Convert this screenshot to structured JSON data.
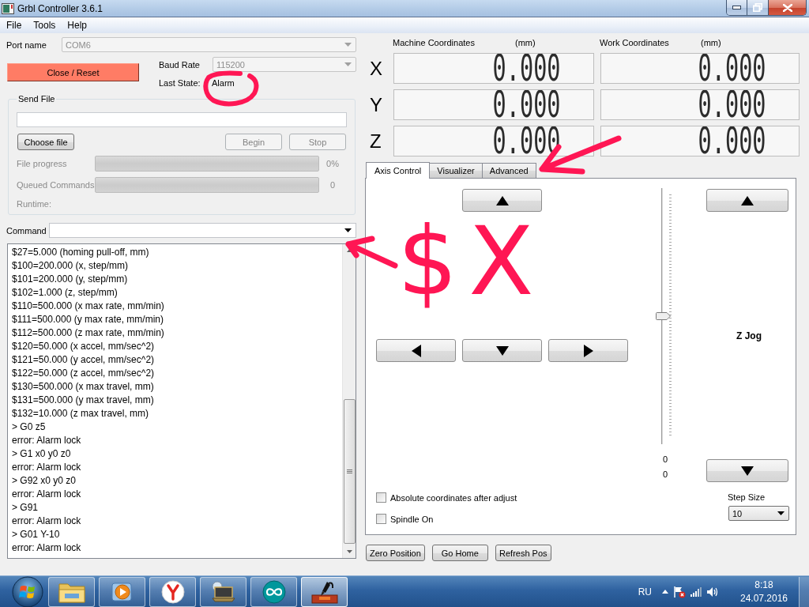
{
  "window": {
    "title": "Grbl Controller 3.6.1"
  },
  "menu": [
    "File",
    "Tools",
    "Help"
  ],
  "connection": {
    "port": {
      "label": "Port name",
      "value": "COM6",
      "disabled": true
    },
    "close_button": {
      "label": "Close / Reset"
    },
    "baud": {
      "label": "Baud Rate",
      "value": "115200",
      "disabled": true
    },
    "last_state": {
      "label": "Last State:",
      "value": "Alarm"
    }
  },
  "send_file": {
    "title": "Send File",
    "buttons": [
      {
        "label": "Choose file",
        "disabled": false
      },
      {
        "label": "Begin",
        "disabled": true
      },
      {
        "label": "Stop",
        "disabled": true
      }
    ],
    "progress": [
      {
        "label": "File progress",
        "level": 0,
        "reading": "0%",
        "disabled": true
      },
      {
        "label": "Queued Commands",
        "level": 0,
        "reading": "0",
        "disabled": true
      }
    ],
    "runtime": {
      "label": "Runtime:",
      "disabled": true
    }
  },
  "command": {
    "label": "Command"
  },
  "console": {
    "lines": [
      "$27=5.000 (homing pull-off, mm)",
      "$100=200.000 (x, step/mm)",
      "$101=200.000 (y, step/mm)",
      "$102=1.000 (z, step/mm)",
      "$110=500.000 (x max rate, mm/min)",
      "$111=500.000 (y max rate, mm/min)",
      "$112=500.000 (z max rate, mm/min)",
      "$120=50.000 (x accel, mm/sec^2)",
      "$121=50.000 (y accel, mm/sec^2)",
      "$122=50.000 (z accel, mm/sec^2)",
      "$130=500.000 (x max travel, mm)",
      "$131=500.000 (y max travel, mm)",
      "$132=10.000 (z max travel, mm)",
      "> G0 z5",
      "error: Alarm lock",
      "> G1 x0 y0 z0",
      "error: Alarm lock",
      "> G92 x0 y0 z0",
      "error: Alarm lock",
      "> G91",
      "error: Alarm lock",
      "> G01 Y-10",
      "error: Alarm lock"
    ]
  },
  "coordinates": {
    "headers": [
      {
        "label": "Machine Coordinates",
        "unit": "(mm)"
      },
      {
        "label": "Work Coordinates",
        "unit": "(mm)"
      }
    ],
    "axes": [
      {
        "axis": "X",
        "machine": "0.000",
        "work": "0.000"
      },
      {
        "axis": "Y",
        "machine": "0.000",
        "work": "0.000"
      },
      {
        "axis": "Z",
        "machine": "0.000",
        "work": "0.000"
      }
    ]
  },
  "tabs": [
    {
      "label": "Axis Control",
      "selected": true
    },
    {
      "label": "Visualizer",
      "selected": false
    },
    {
      "label": "Advanced",
      "selected": false
    }
  ],
  "axis_control": {
    "xy_jog": [
      {
        "kind": "up"
      },
      {
        "kind": "left"
      },
      {
        "kind": "down"
      },
      {
        "kind": "right"
      }
    ],
    "z_jog": {
      "label": "Z Jog",
      "buttons": [
        {
          "kind": "up"
        },
        {
          "kind": "down"
        }
      ],
      "slider": {
        "level": 0.5
      },
      "readings": [
        "0",
        "0"
      ]
    },
    "options": [
      {
        "label": "Absolute coordinates after adjust",
        "checked": false
      },
      {
        "label": "Spindle On",
        "checked": false
      }
    ],
    "step_size": {
      "label": "Step Size",
      "value": "10"
    }
  },
  "bottom_buttons": [
    "Zero Position",
    "Go Home",
    "Refresh Pos"
  ],
  "taskbar": {
    "apps": [
      {
        "selected": false
      },
      {
        "selected": false
      },
      {
        "selected": false
      },
      {
        "selected": false
      },
      {
        "selected": false
      },
      {
        "selected": true
      }
    ],
    "language": "RU",
    "time": "8:18",
    "date": "24.07.2016"
  },
  "annotations": [
    {
      "kind": "circle"
    },
    {
      "kind": "arrow"
    },
    {
      "kind": "arrow"
    },
    {
      "kind": "text",
      "text": "$X"
    }
  ]
}
